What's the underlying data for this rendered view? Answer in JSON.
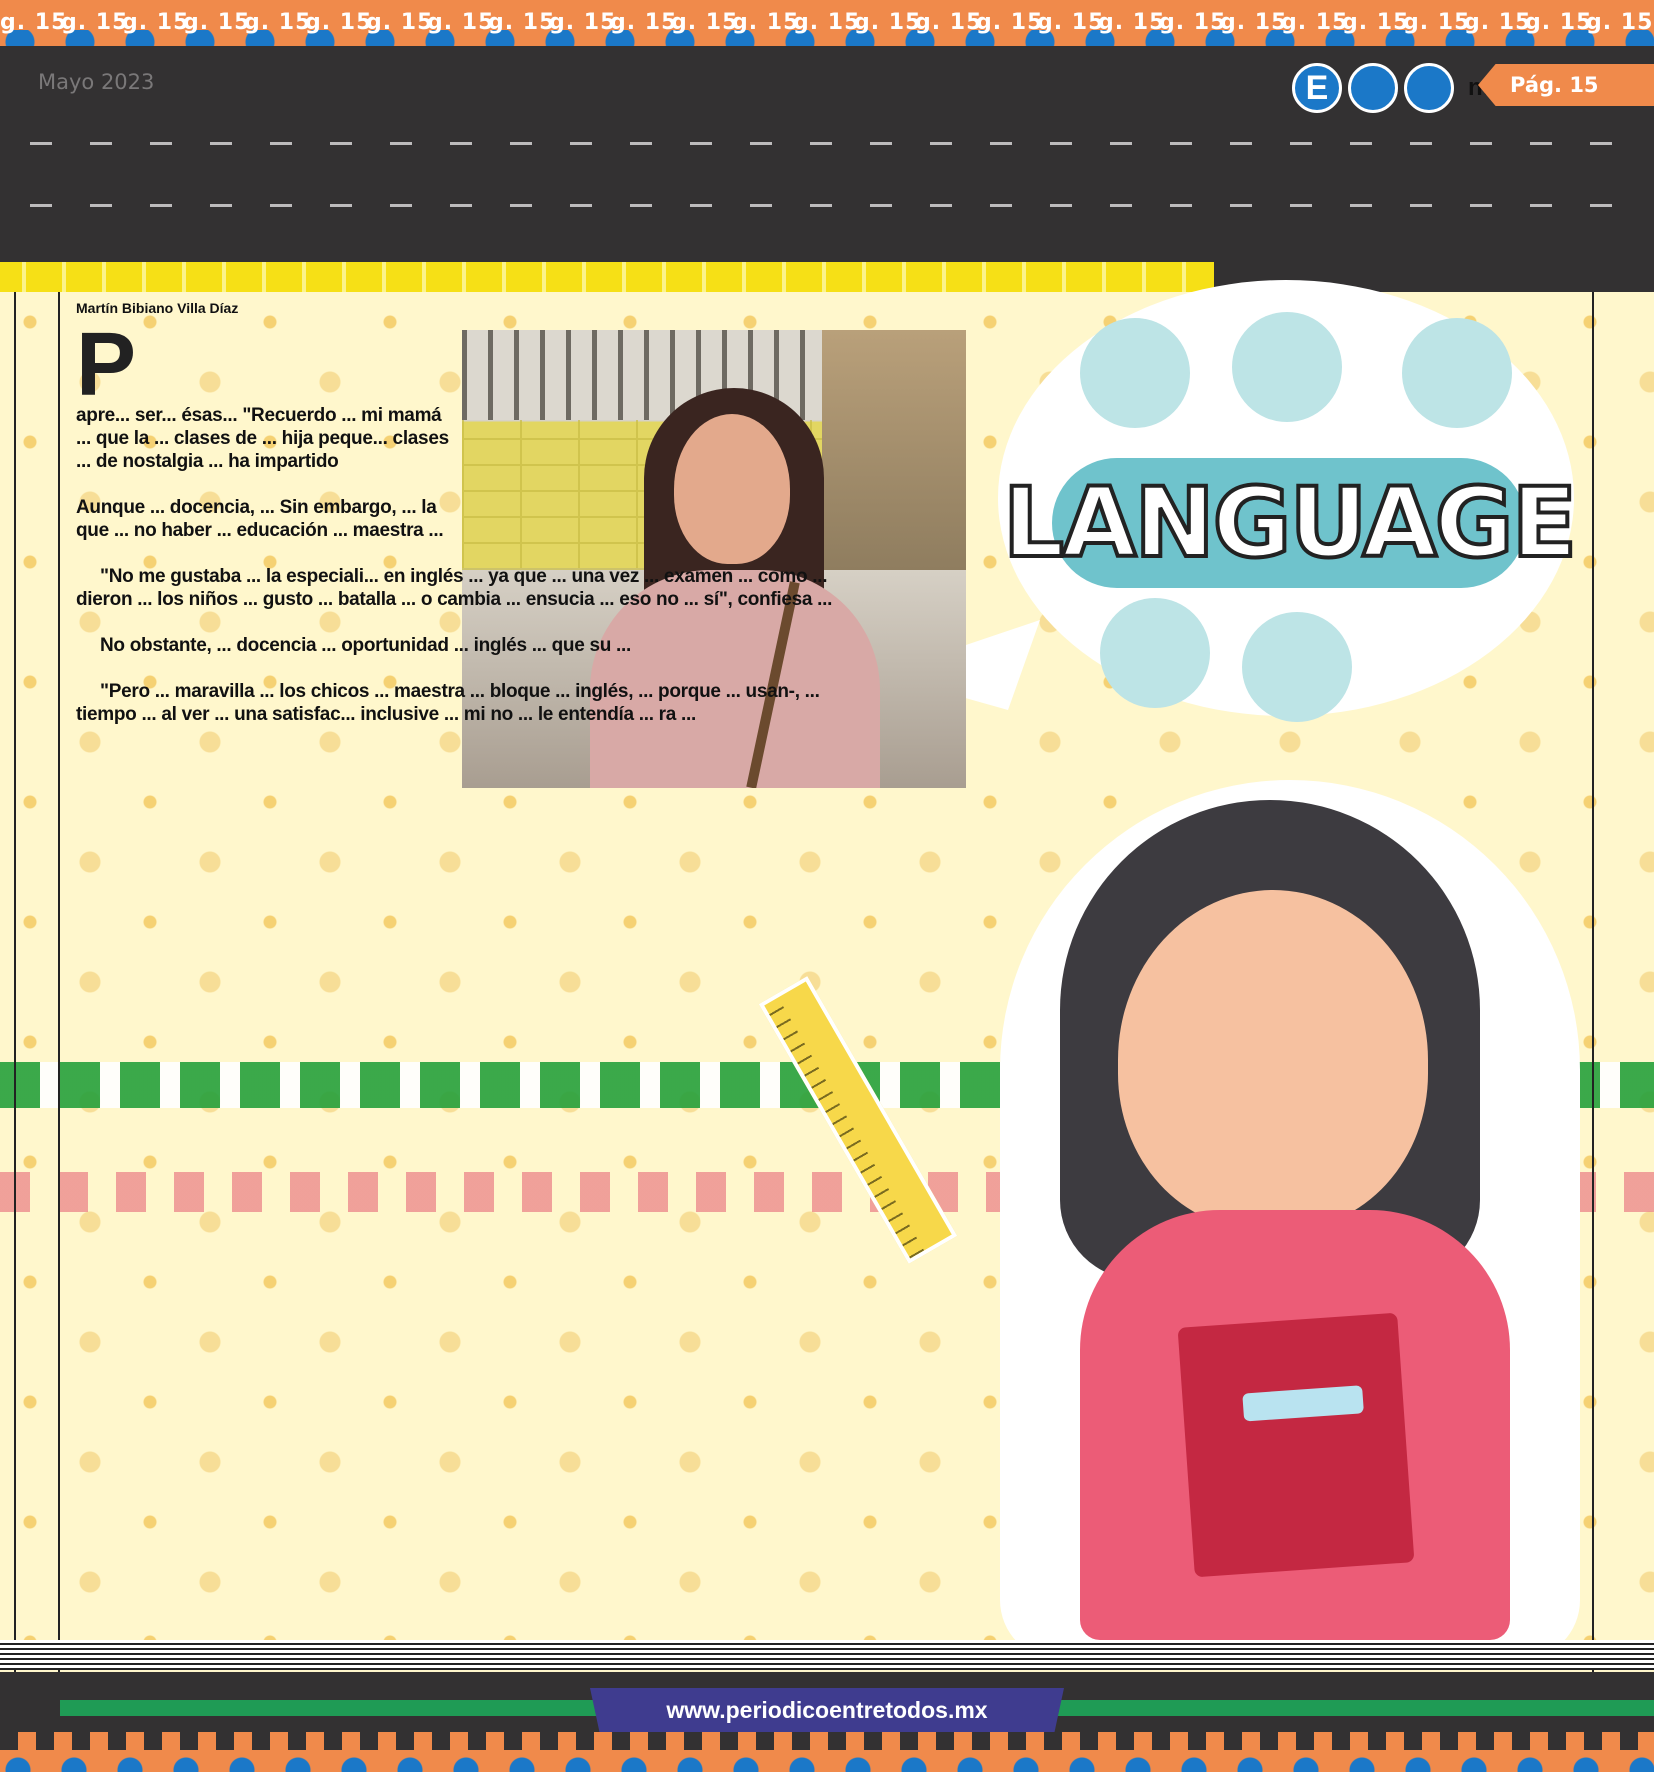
{
  "page": {
    "number_label": "Pág. 15",
    "repeat_token": "g. 15",
    "date": "Mayo 2023"
  },
  "brand": {
    "initial": "E",
    "name": "ntretodos"
  },
  "article": {
    "byline": "Martín Bibiano Villa Díaz",
    "dropcap": "P",
    "paragraphs": [
      "apre... ser... ésas... \"Recuerdo ... mi mamá ... que la ... clases de ... hija peque... clases ... de nostalgia ... ha impartido",
      "Aunque ... docencia, ... Sin embargo, ... la que ... no haber ... educación ... maestra ...",
      "\"No me gustaba ... la especiali... en inglés ... ya que ... una vez ... examen ... como ... dieron ... los niños ... gusto ... batalla ... o cambia ... ensucia ... eso no ... sí\", confiesa ...",
      "No obstante, ... docencia ... oportunidad ... inglés ... que su ...",
      "\"Pero ... maravilla ... los chicos ... maestra ... bloque ... inglés, ... porque ... usan-, ... tiempo ... al ver ... una satisfac... inclusive ... mi no ... le entendía ... ra ..."
    ]
  },
  "photo": {
    "subject": "teacher-portrait"
  },
  "illustration": {
    "bubble_word": "LANGUAGE"
  },
  "footer": {
    "url": "www.periodicoentretodos.mx"
  },
  "colors": {
    "orange": "#f08a4b",
    "blue": "#1b78c8",
    "dark": "#333132",
    "yellow": "#f6e016",
    "navy": "#3f3c8f",
    "green": "#1f9b55"
  }
}
